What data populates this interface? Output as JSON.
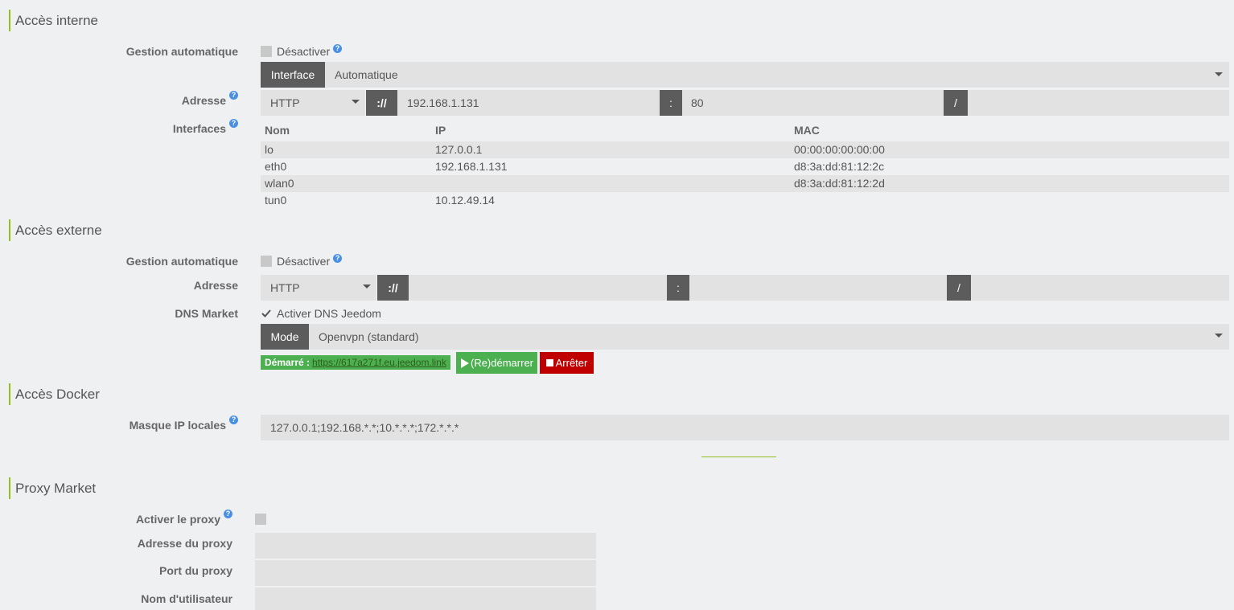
{
  "interne": {
    "title": "Accès interne",
    "gestion_label": "Gestion automatique",
    "disable_label": "Désactiver",
    "interface_btn": "Interface",
    "interface_value": "Automatique",
    "adresse_label": "Adresse",
    "protocol": "HTTP",
    "sep_proto": "://",
    "ip": "192.168.1.131",
    "sep_port": ":",
    "port": "80",
    "sep_path": "/",
    "interfaces_label": "Interfaces",
    "table": {
      "headers": [
        "Nom",
        "IP",
        "MAC"
      ],
      "rows": [
        [
          "lo",
          "127.0.0.1",
          "00:00:00:00:00:00"
        ],
        [
          "eth0",
          "192.168.1.131",
          "d8:3a:dd:81:12:2c"
        ],
        [
          "wlan0",
          "",
          "d8:3a:dd:81:12:2d"
        ],
        [
          "tun0",
          "10.12.49.14",
          ""
        ]
      ]
    }
  },
  "externe": {
    "title": "Accès externe",
    "gestion_label": "Gestion automatique",
    "disable_label": "Désactiver",
    "adresse_label": "Adresse",
    "protocol": "HTTP",
    "sep_proto": "://",
    "sep_port": ":",
    "sep_path": "/",
    "dns_label": "DNS Market",
    "dns_checkbox_label": "Activer DNS Jeedom",
    "mode_btn": "Mode",
    "mode_value": "Openvpn (standard)",
    "status_prefix": "Démarré :",
    "status_link": "https://617a271f.eu.jeedom.link",
    "restart_label": "(Re)démarrer",
    "stop_label": "Arrêter"
  },
  "docker": {
    "title": "Accès Docker",
    "mask_label": "Masque IP locales",
    "mask_value": "127.0.0.1;192.168.*.*;10.*.*.*;172.*.*.*"
  },
  "proxy": {
    "title": "Proxy Market",
    "enable_label": "Activer le proxy",
    "address_label": "Adresse du proxy",
    "port_label": "Port du proxy",
    "user_label": "Nom d'utilisateur"
  },
  "colors": {
    "accent": "#94c01f",
    "help": "#4a90e2",
    "dark_addon": "#5c5c5c",
    "success": "#4caf50",
    "danger": "#c00000"
  }
}
